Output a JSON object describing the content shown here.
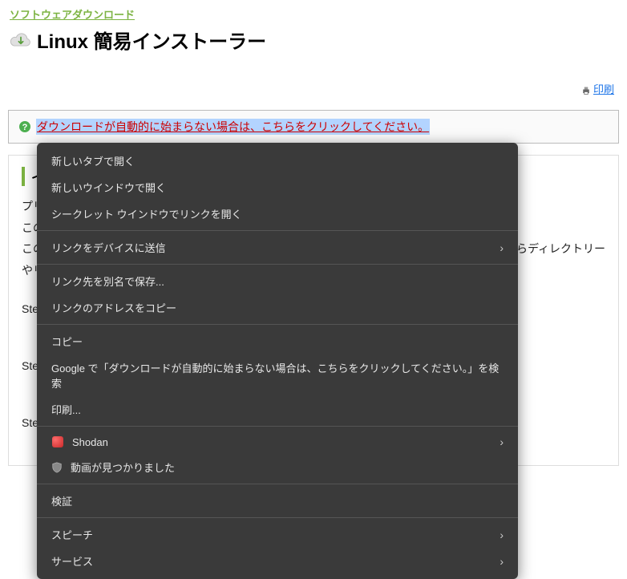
{
  "header": {
    "breadcrumb": "ソフトウェアダウンロード",
    "title": "Linux 簡易インストーラー"
  },
  "print": {
    "label": "印刷"
  },
  "alert": {
    "link_text": "ダウンロードが自動的に始まらない場合は、こちらをクリックしてください。"
  },
  "section": {
    "heading_trunc": "イ",
    "p1_prefix": "プリ",
    "p2_prefix": "この",
    "p3_prefix": "この",
    "p3_suffix": "らディレクトリー",
    "p4_prefix": "やリ",
    "step1": "Ste",
    "step2": "Ste",
    "step3": "Ste"
  },
  "menu": {
    "open_new_tab": "新しいタブで開く",
    "open_new_window": "新しいウインドウで開く",
    "open_incognito": "シークレット ウインドウでリンクを開く",
    "send_to_device": "リンクをデバイスに送信",
    "save_link_as": "リンク先を別名で保存...",
    "copy_link": "リンクのアドレスをコピー",
    "copy": "コピー",
    "google_search": "Google で「ダウンロードが自動的に始まらない場合は、こちらをクリックしてください。」を検索",
    "print": "印刷...",
    "shodan": "Shodan",
    "video_found": "動画が見つかりました",
    "inspect": "検証",
    "speech": "スピーチ",
    "services": "サービス"
  }
}
